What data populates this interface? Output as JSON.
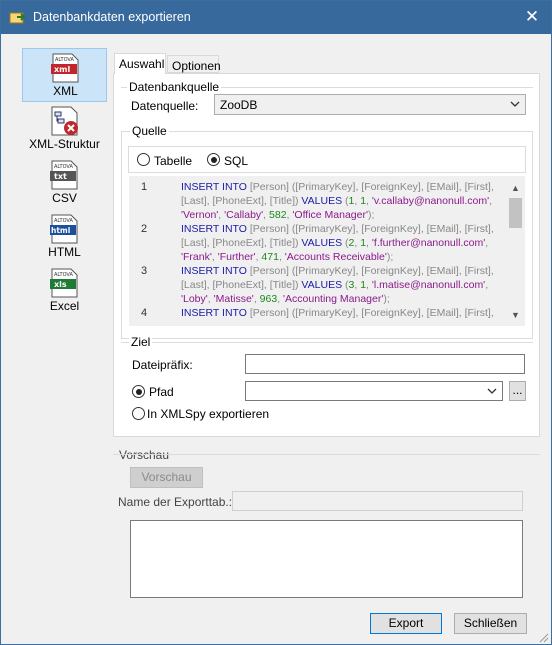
{
  "window": {
    "title": "Datenbankdaten exportieren",
    "close_symbol": "✕"
  },
  "nav": [
    {
      "id": "xml",
      "label": "XML",
      "icon": "xml-file-icon",
      "badge": "xml",
      "selected": true
    },
    {
      "id": "xml-struct",
      "label": "XML-Struktur",
      "icon": "xml-structure-icon",
      "selected": false
    },
    {
      "id": "csv",
      "label": "CSV",
      "icon": "csv-file-icon",
      "badge": "txt",
      "selected": false
    },
    {
      "id": "html",
      "label": "HTML",
      "icon": "html-file-icon",
      "badge": "html",
      "selected": false
    },
    {
      "id": "excel",
      "label": "Excel",
      "icon": "excel-file-icon",
      "badge": "xls",
      "selected": false
    }
  ],
  "icon_vendor_text": "ALTOVA",
  "tabs": [
    {
      "label": "Auswahl",
      "active": true
    },
    {
      "label": "Optionen",
      "active": false
    }
  ],
  "source_group": {
    "title": "Datenbankquelle",
    "label": "Datenquelle:",
    "value": "ZooDB"
  },
  "quelle_group": {
    "title": "Quelle",
    "table_label": "Tabelle",
    "sql_label": "SQL",
    "selected": "SQL"
  },
  "sql_lines": [
    {
      "n": "1",
      "parts": [
        {
          "t": "INSERT INTO",
          "c": "kw"
        },
        {
          "t": " [Person] ([PrimaryKey], [ForeignKey], [EMail], [First], [Last], [PhoneExt], [Title]) ",
          "c": ""
        },
        {
          "t": "VALUES",
          "c": "kw"
        },
        {
          "t": " (",
          "c": ""
        },
        {
          "t": "1",
          "c": "num"
        },
        {
          "t": ", ",
          "c": ""
        },
        {
          "t": "1",
          "c": "num"
        },
        {
          "t": ", ",
          "c": ""
        },
        {
          "t": "'v.callaby@nanonull.com'",
          "c": "str"
        },
        {
          "t": ", ",
          "c": ""
        },
        {
          "t": "'Vernon'",
          "c": "str"
        },
        {
          "t": ", ",
          "c": ""
        },
        {
          "t": "'Callaby'",
          "c": "str"
        },
        {
          "t": ", ",
          "c": ""
        },
        {
          "t": "582",
          "c": "num"
        },
        {
          "t": ", ",
          "c": ""
        },
        {
          "t": "'Office Manager'",
          "c": "str"
        },
        {
          "t": ");",
          "c": ""
        }
      ]
    },
    {
      "n": "2",
      "parts": [
        {
          "t": "INSERT INTO",
          "c": "kw"
        },
        {
          "t": " [Person] ([PrimaryKey], [ForeignKey], [EMail], [First], [Last], [PhoneExt], [Title]) ",
          "c": ""
        },
        {
          "t": "VALUES",
          "c": "kw"
        },
        {
          "t": " (",
          "c": ""
        },
        {
          "t": "2",
          "c": "num"
        },
        {
          "t": ", ",
          "c": ""
        },
        {
          "t": "1",
          "c": "num"
        },
        {
          "t": ", ",
          "c": ""
        },
        {
          "t": "'f.further@nanonull.com'",
          "c": "str"
        },
        {
          "t": ", ",
          "c": ""
        },
        {
          "t": "'Frank'",
          "c": "str"
        },
        {
          "t": ", ",
          "c": ""
        },
        {
          "t": "'Further'",
          "c": "str"
        },
        {
          "t": ", ",
          "c": ""
        },
        {
          "t": "471",
          "c": "num"
        },
        {
          "t": ", ",
          "c": ""
        },
        {
          "t": "'Accounts Receivable'",
          "c": "str"
        },
        {
          "t": ");",
          "c": ""
        }
      ]
    },
    {
      "n": "3",
      "parts": [
        {
          "t": "INSERT INTO",
          "c": "kw"
        },
        {
          "t": " [Person] ([PrimaryKey], [ForeignKey], [EMail], [First], [Last], [PhoneExt], [Title]) ",
          "c": ""
        },
        {
          "t": "VALUES",
          "c": "kw"
        },
        {
          "t": " (",
          "c": ""
        },
        {
          "t": "3",
          "c": "num"
        },
        {
          "t": ", ",
          "c": ""
        },
        {
          "t": "1",
          "c": "num"
        },
        {
          "t": ", ",
          "c": ""
        },
        {
          "t": "'l.matise@nanonull.com'",
          "c": "str"
        },
        {
          "t": ", ",
          "c": ""
        },
        {
          "t": "'Loby'",
          "c": "str"
        },
        {
          "t": ", ",
          "c": ""
        },
        {
          "t": "'Matisse'",
          "c": "str"
        },
        {
          "t": ", ",
          "c": ""
        },
        {
          "t": "963",
          "c": "num"
        },
        {
          "t": ", ",
          "c": ""
        },
        {
          "t": "'Accounting Manager'",
          "c": "str"
        },
        {
          "t": ");",
          "c": ""
        }
      ]
    },
    {
      "n": "4",
      "parts": [
        {
          "t": "INSERT INTO",
          "c": "kw"
        },
        {
          "t": " [Person] ([PrimaryKey], [ForeignKey], [EMail], [First],",
          "c": ""
        }
      ]
    }
  ],
  "ziel_group": {
    "title": "Ziel",
    "prefix_label": "Dateipräfix:",
    "prefix_value": "",
    "path_label": "Pfad",
    "path_value": "",
    "browse_label": "...",
    "xmlspy_label": "In XMLSpy exportieren",
    "selected": "Pfad"
  },
  "preview": {
    "title": "Vorschau",
    "button_label": "Vorschau",
    "export_table_label": "Name der Exporttab.:",
    "export_table_value": ""
  },
  "buttons": {
    "export": "Export",
    "close": "Schließen"
  },
  "colors": {
    "titlebar": "#38699c",
    "keyword": "#1a1aa8",
    "string": "#8a1a8a",
    "number": "#1a8a1a",
    "selected_nav": "#cce4f7"
  }
}
